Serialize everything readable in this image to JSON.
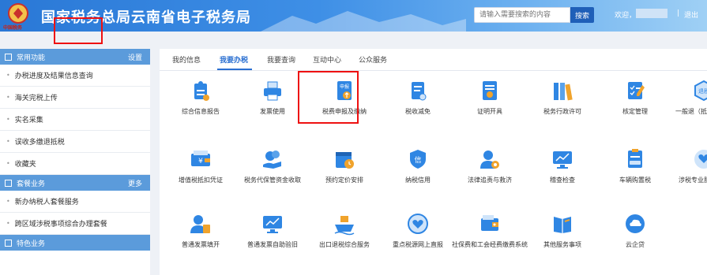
{
  "header": {
    "emblem_text": "中国税务",
    "title": "国家税务总局云南省电子税务局",
    "search_placeholder": "请输入需要搜索的内容",
    "search_button": "搜索",
    "welcome": "欢迎，",
    "separator": "|",
    "logout": "退出"
  },
  "sidebar": {
    "sections": [
      {
        "title": "常用功能",
        "action": "设置",
        "items": [
          "办税进度及结果信息查询",
          "海关完税上传",
          "实名采集",
          "误收多缴退抵税",
          "收藏夹"
        ]
      },
      {
        "title": "套餐业务",
        "action": "更多",
        "items": [
          "新办纳税人套餐服务",
          "跨区域涉税事项综合办理套餐"
        ]
      },
      {
        "title": "特色业务",
        "action": "",
        "items": []
      }
    ]
  },
  "tabs": [
    "我的信息",
    "我要办税",
    "我要查询",
    "互动中心",
    "公众服务"
  ],
  "active_tab": "我要办税",
  "services": [
    {
      "label": "综合信息报告",
      "icon": "info-report-icon"
    },
    {
      "label": "发票使用",
      "icon": "printer-icon"
    },
    {
      "label": "税费申报及缴纳",
      "icon": "tax-declaration-icon"
    },
    {
      "label": "税收减免",
      "icon": "tax-relief-icon"
    },
    {
      "label": "证明开具",
      "icon": "certificate-icon"
    },
    {
      "label": "税务行政许可",
      "icon": "binders-icon"
    },
    {
      "label": "核定管理",
      "icon": "checklist-icon"
    },
    {
      "label": "一般退（抵）税管理",
      "icon": "refund-icon"
    },
    {
      "label": "增值税抵扣凭证",
      "icon": "vat-voucher-icon"
    },
    {
      "label": "税务代保管资金收取",
      "icon": "money-hand-icon"
    },
    {
      "label": "预约定价安排",
      "icon": "calendar-clock-icon"
    },
    {
      "label": "纳税信用",
      "icon": "credit-shield-icon"
    },
    {
      "label": "法律追责与救济",
      "icon": "user-gear-icon"
    },
    {
      "label": "稽查检查",
      "icon": "monitor-chart-icon"
    },
    {
      "label": "车辆购置税",
      "icon": "vehicle-clipboard-icon"
    },
    {
      "label": "涉税专业服务机构",
      "icon": "heart-hand-icon"
    },
    {
      "label": "普通发票填开",
      "icon": "user-invoice-icon"
    },
    {
      "label": "普通发票自助验旧",
      "icon": "monitor-chart-icon"
    },
    {
      "label": "出口退税综合服务",
      "icon": "ship-icon"
    },
    {
      "label": "重点税源网上直报",
      "icon": "heart-circle-icon"
    },
    {
      "label": "社保费和工会经费缴费系统",
      "icon": "wallet-icon"
    },
    {
      "label": "其他服务事项",
      "icon": "book-icon"
    },
    {
      "label": "云企贷",
      "icon": "cloud-loan-icon"
    }
  ],
  "colors": {
    "brand_blue": "#2a6fd1",
    "header_blue": "#2a78d6",
    "sidebar_header": "#5b9bdb",
    "highlight_red": "#ee1111",
    "icon_blue": "#2f86e3",
    "icon_orange": "#f0a32c"
  }
}
